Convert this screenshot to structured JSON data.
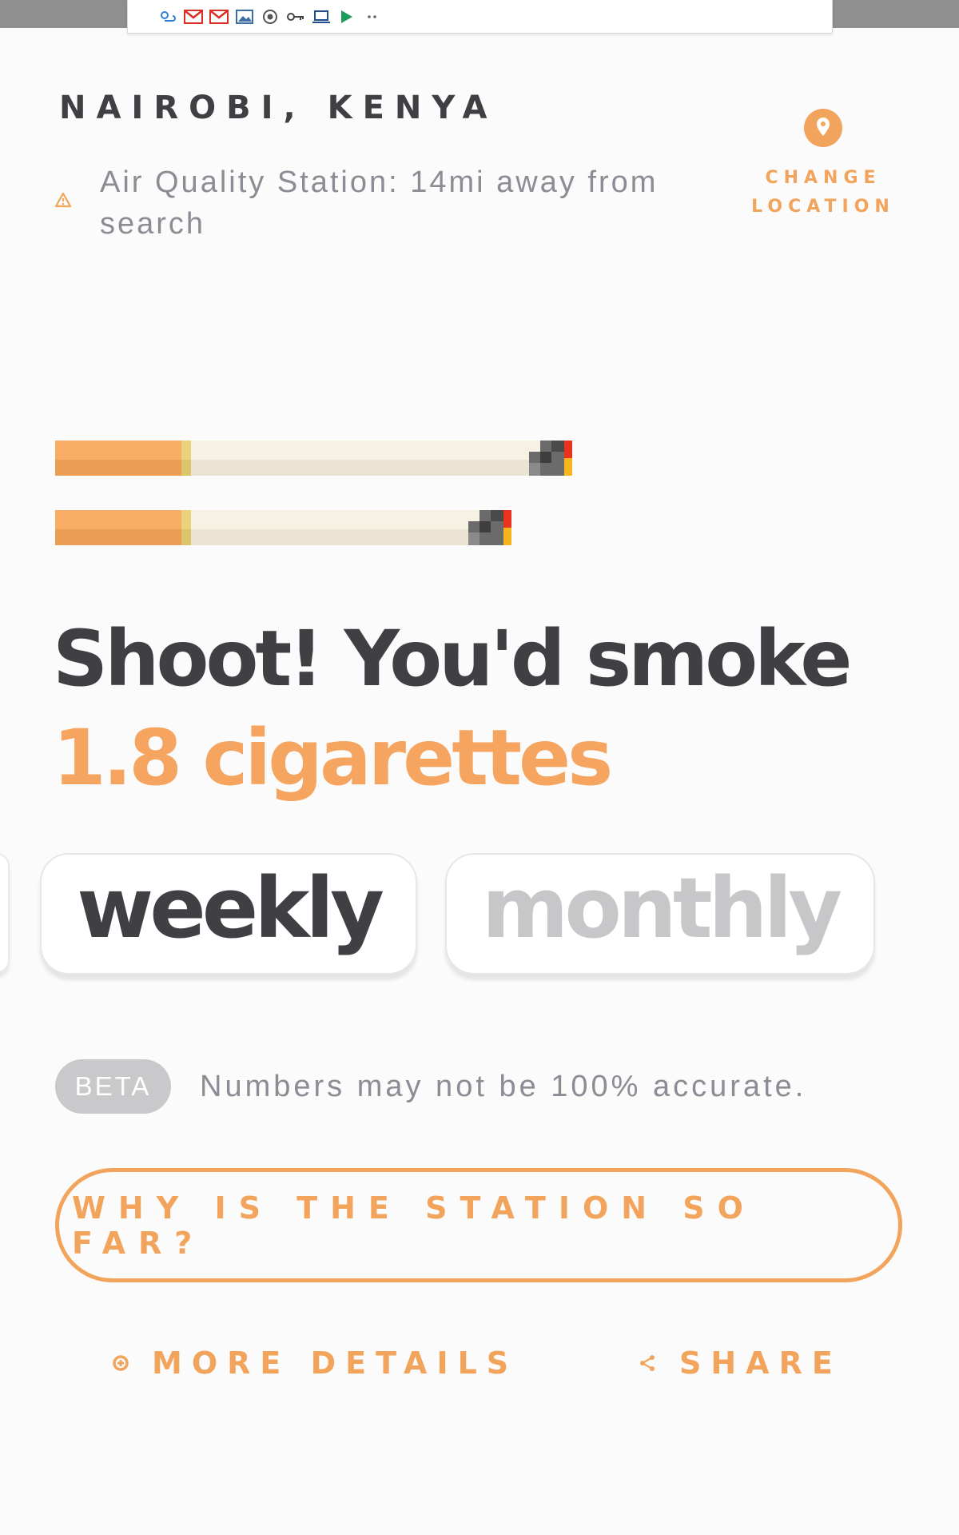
{
  "status_bar": {
    "icons": [
      "weather-icon",
      "gmail-icon",
      "gmail-icon",
      "gallery-icon",
      "chrome-icon",
      "vpn-key-icon",
      "laptop-icon",
      "play-store-icon",
      "more-dots-icon"
    ]
  },
  "location": {
    "city": "NAIROBI, KENYA",
    "station_note": "Air Quality Station: 14mi away from search",
    "change_label": "CHANGE LOCATION"
  },
  "cigarettes": {
    "count": 1.8,
    "headline_prefix": "Shoot! You'd smoke",
    "headline_value": "1.8 cigarettes"
  },
  "period_tabs": {
    "items": [
      {
        "label": "weekly",
        "selected": true
      },
      {
        "label": "monthly",
        "selected": false
      }
    ]
  },
  "beta": {
    "badge": "BETA",
    "note": "Numbers may not be 100% accurate."
  },
  "actions": {
    "why_button": "WHY IS THE STATION SO FAR?",
    "more_details": "MORE DETAILS",
    "share": "SHARE"
  },
  "colors": {
    "accent": "#f2a45c",
    "text_dark": "#3f3f44",
    "text_muted": "#8c8c94",
    "inactive": "#c7c7c9"
  }
}
